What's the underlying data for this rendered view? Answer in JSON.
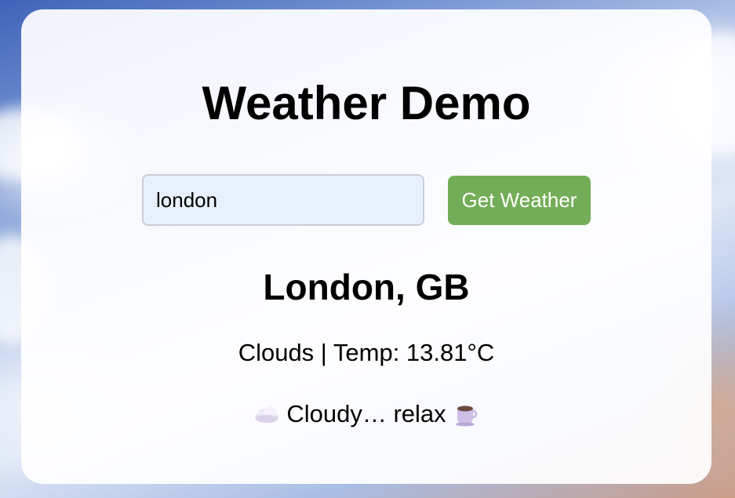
{
  "app": {
    "title": "Weather Demo"
  },
  "search": {
    "value": "london",
    "button_label": "Get Weather"
  },
  "weather": {
    "location": "London, GB",
    "details": "Clouds | Temp: 13.81°C",
    "mood_text": "Cloudy… relax",
    "mood_icon_left": "cloud-icon",
    "mood_icon_right": "coffee-cup-icon"
  },
  "colors": {
    "button": "#74ad58",
    "input_background": "#e8f0fe"
  }
}
